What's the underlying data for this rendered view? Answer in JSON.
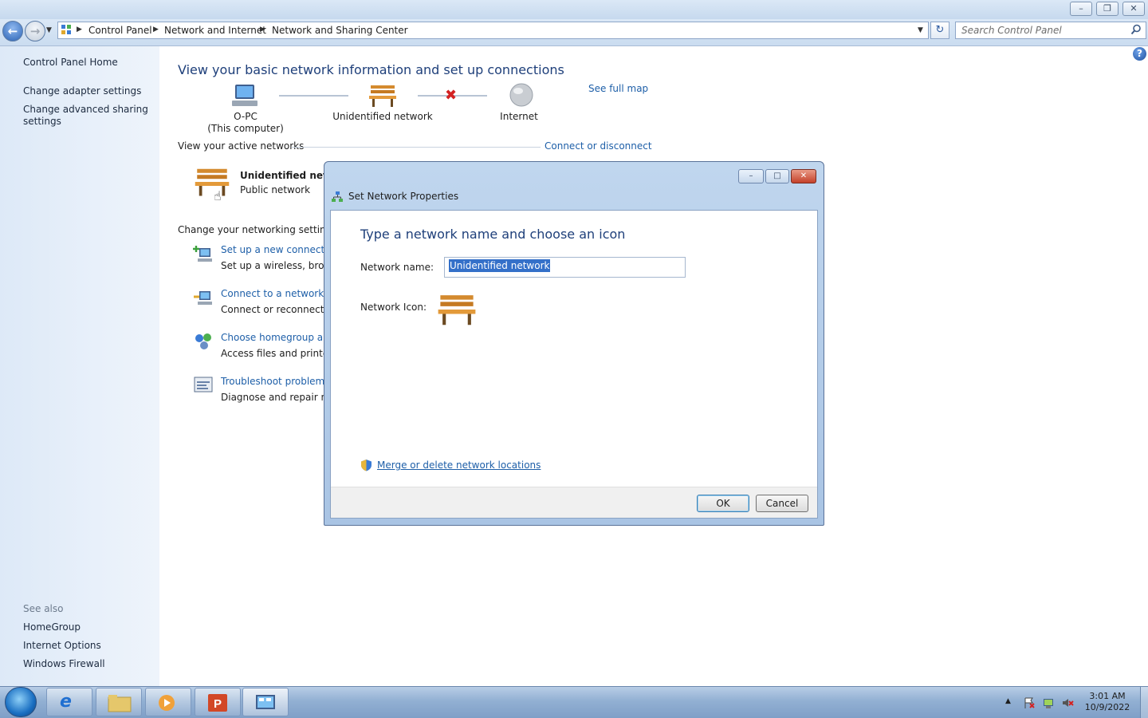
{
  "window": {
    "breadcrumb": [
      "Control Panel",
      "Network and Internet",
      "Network and Sharing Center"
    ],
    "search_placeholder": "Search Control Panel",
    "help_label": "?"
  },
  "sidebar": {
    "home": "Control Panel Home",
    "items": [
      "Change adapter settings",
      "Change advanced sharing",
      "settings"
    ],
    "see_also_title": "See also",
    "see_also": [
      "HomeGroup",
      "Internet Options",
      "Windows Firewall"
    ]
  },
  "main": {
    "title": "View your basic network information and set up connections",
    "see_full_map": "See full map",
    "map": {
      "computer_name": "O-PC",
      "computer_sub": "(This computer)",
      "network": "Unidentified network",
      "internet": "Internet"
    },
    "active_networks_label": "View your active networks",
    "connect_disconnect": "Connect or disconnect",
    "active_network_name": "Unidentified netw",
    "active_network_type": "Public network",
    "settings_label": "Change your networking settings",
    "tasks": [
      {
        "link": "Set up a new connection",
        "desc": "Set up a wireless, broadb"
      },
      {
        "link": "Connect to a network",
        "desc": "Connect or reconnect to"
      },
      {
        "link": "Choose homegroup and",
        "desc": "Access files and printers"
      },
      {
        "link": "Troubleshoot problems",
        "desc": "Diagnose and repair netv"
      }
    ]
  },
  "dialog": {
    "title": "Set Network Properties",
    "heading": "Type a network name and choose an icon",
    "name_label": "Network name:",
    "name_value": "Unidentified network",
    "icon_label": "Network Icon:",
    "merge_link": "Merge or delete network locations",
    "ok": "OK",
    "cancel": "Cancel"
  },
  "taskbar": {
    "time": "3:01 AM",
    "date": "10/9/2022"
  }
}
